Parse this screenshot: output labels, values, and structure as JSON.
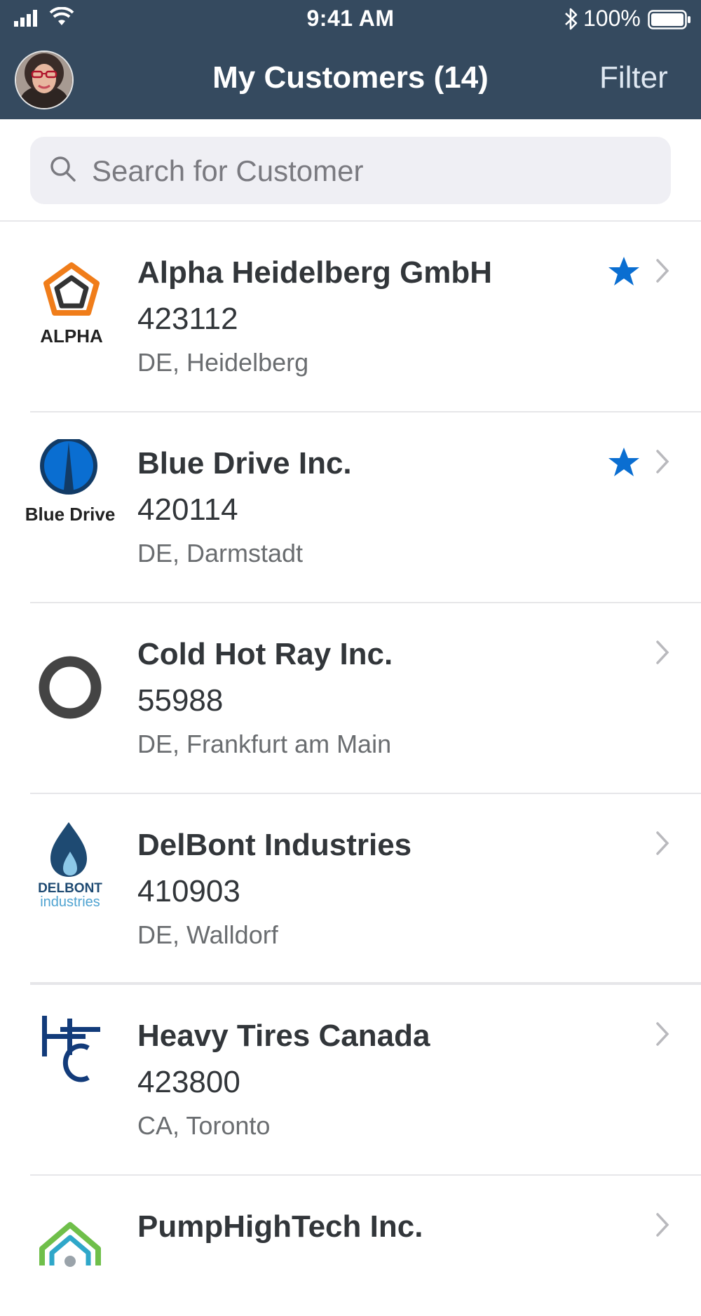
{
  "status_bar": {
    "time": "9:41 AM",
    "battery": "100%"
  },
  "header": {
    "title": "My Customers (14)",
    "filter_label": "Filter"
  },
  "search": {
    "placeholder": "Search for Customer"
  },
  "customers": [
    {
      "name": "Alpha Heidelberg GmbH",
      "id": "423112",
      "location": "DE, Heidelberg",
      "favorite": true,
      "logo_text": "ALPHA"
    },
    {
      "name": "Blue Drive Inc.",
      "id": "420114",
      "location": "DE, Darmstadt",
      "favorite": true,
      "logo_text": "Blue Drive"
    },
    {
      "name": "Cold Hot Ray Inc.",
      "id": "55988",
      "location": "DE, Frankfurt am Main",
      "favorite": false
    },
    {
      "name": "DelBont Industries",
      "id": "410903",
      "location": "DE, Walldorf",
      "favorite": false,
      "logo_text": "DELBONT",
      "logo_subtext": "industries"
    },
    {
      "name": "Heavy Tires Canada",
      "id": "423800",
      "location": "CA, Toronto",
      "favorite": false
    },
    {
      "name": "PumpHighTech Inc.",
      "favorite": false
    }
  ],
  "colors": {
    "header_bg": "#354a5f",
    "star": "#0a6ed1",
    "text": "#32363a",
    "subtext": "#6a6d70"
  }
}
